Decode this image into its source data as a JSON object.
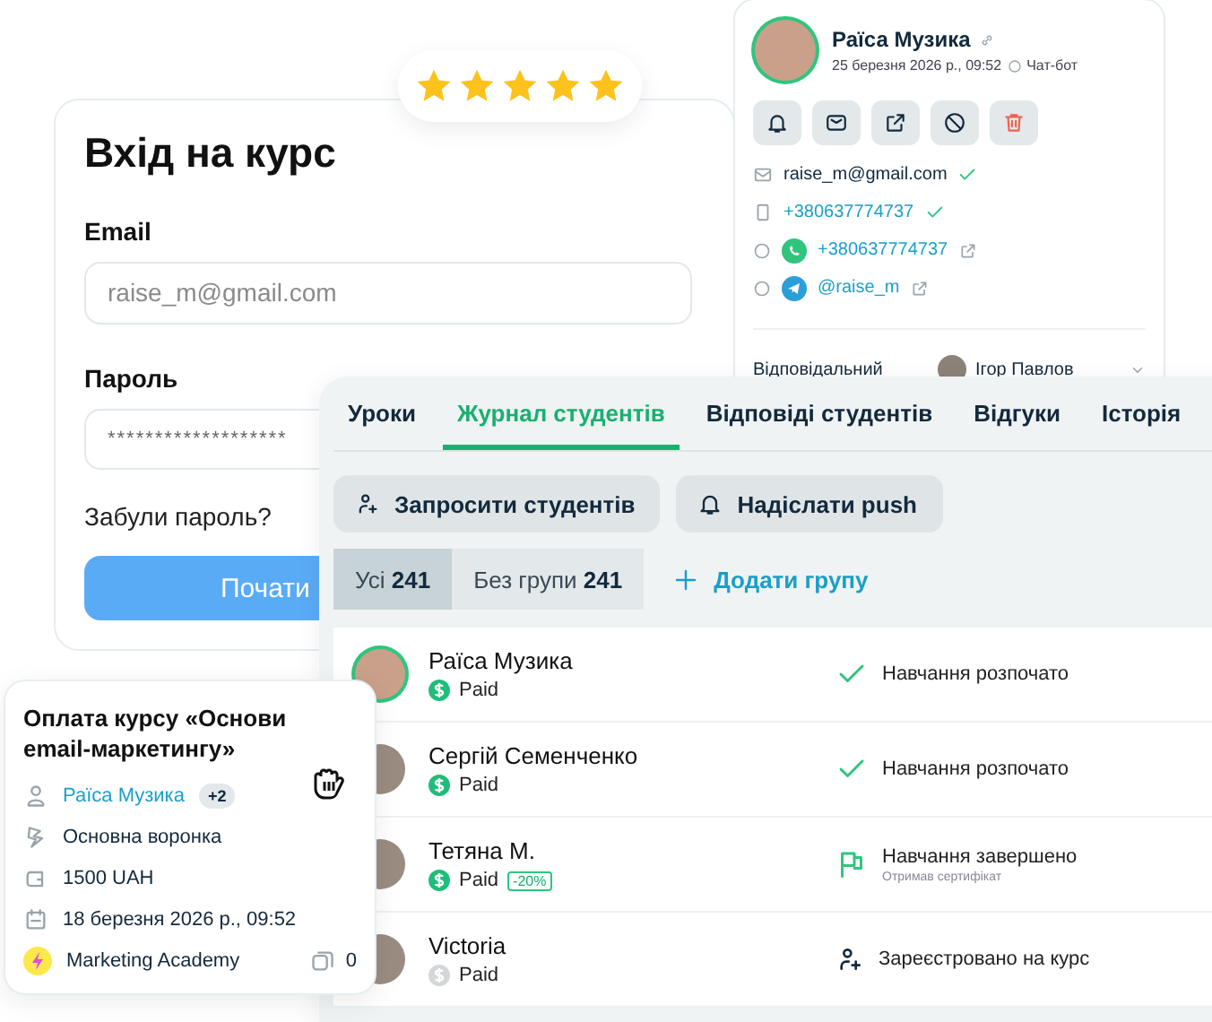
{
  "login": {
    "title": "Вхід на курс",
    "fields": [
      {
        "label": "Email",
        "placeholder": "raise_m@gmail.com"
      },
      {
        "label": "Пароль",
        "value": "*******************"
      }
    ],
    "forgot_link": "Забули пароль?",
    "submit_button": "Почати"
  },
  "rating": {
    "stars": 5
  },
  "contact": {
    "name": "Раїса Музика",
    "date": "25 березня 2026 р., 09:52",
    "source": "Чат-бот",
    "channels": [
      {
        "kind": "email",
        "value": "raise_m@gmail.com",
        "verified": true
      },
      {
        "kind": "phone",
        "value": "+380637774737",
        "verified": true
      },
      {
        "kind": "whatsapp",
        "value": "+380637774737",
        "verified": false
      },
      {
        "kind": "telegram",
        "value": "@raise_m",
        "verified": false
      }
    ],
    "responsible_label": "Відповідальний",
    "responsible_name": "Ігор Павлов"
  },
  "journal": {
    "tabs": [
      {
        "label": "Уроки",
        "selected": false
      },
      {
        "label": "Журнал студентів",
        "selected": true
      },
      {
        "label": "Відповіді студентів",
        "selected": false
      },
      {
        "label": "Відгуки",
        "selected": false
      },
      {
        "label": "Історія",
        "selected": false
      }
    ],
    "actions": [
      {
        "kind": "invite",
        "label": "Запросити студентів"
      },
      {
        "kind": "push",
        "label": "Надіслати push"
      }
    ],
    "groups": [
      {
        "label": "Усі",
        "count": "241",
        "selected": true
      },
      {
        "label": "Без групи",
        "count": "241",
        "selected": false
      }
    ],
    "add_group": "Додати групу",
    "students": [
      {
        "name": "Раїса Музика",
        "highlighted": true,
        "payment": "Paid",
        "payment_confirmed": true,
        "kind": "started",
        "status": "Навчання розпочато"
      },
      {
        "name": "Сергій Семенченко",
        "highlighted": false,
        "payment": "Paid",
        "payment_confirmed": true,
        "kind": "started",
        "status": "Навчання розпочато"
      },
      {
        "name": "Тетяна М.",
        "highlighted": false,
        "payment": "Paid",
        "payment_confirmed": true,
        "discount": "-20%",
        "kind": "finished",
        "status": "Навчання завершено",
        "status_note": "Отримав сертифікат"
      },
      {
        "name": "Victoria",
        "highlighted": false,
        "payment": "Paid",
        "payment_confirmed": false,
        "kind": "registered",
        "status": "Зареєстровано на курс"
      }
    ]
  },
  "payment_card": {
    "title": "Оплата курсу «Основи email-маркетингу»",
    "client": "Раїса Музика",
    "extra_clients": "+2",
    "funnel": "Основна воронка",
    "amount": "1500 UAH",
    "date": "18 березня 2026 р., 09:52",
    "company": "Marketing Academy",
    "comments": "0"
  }
}
